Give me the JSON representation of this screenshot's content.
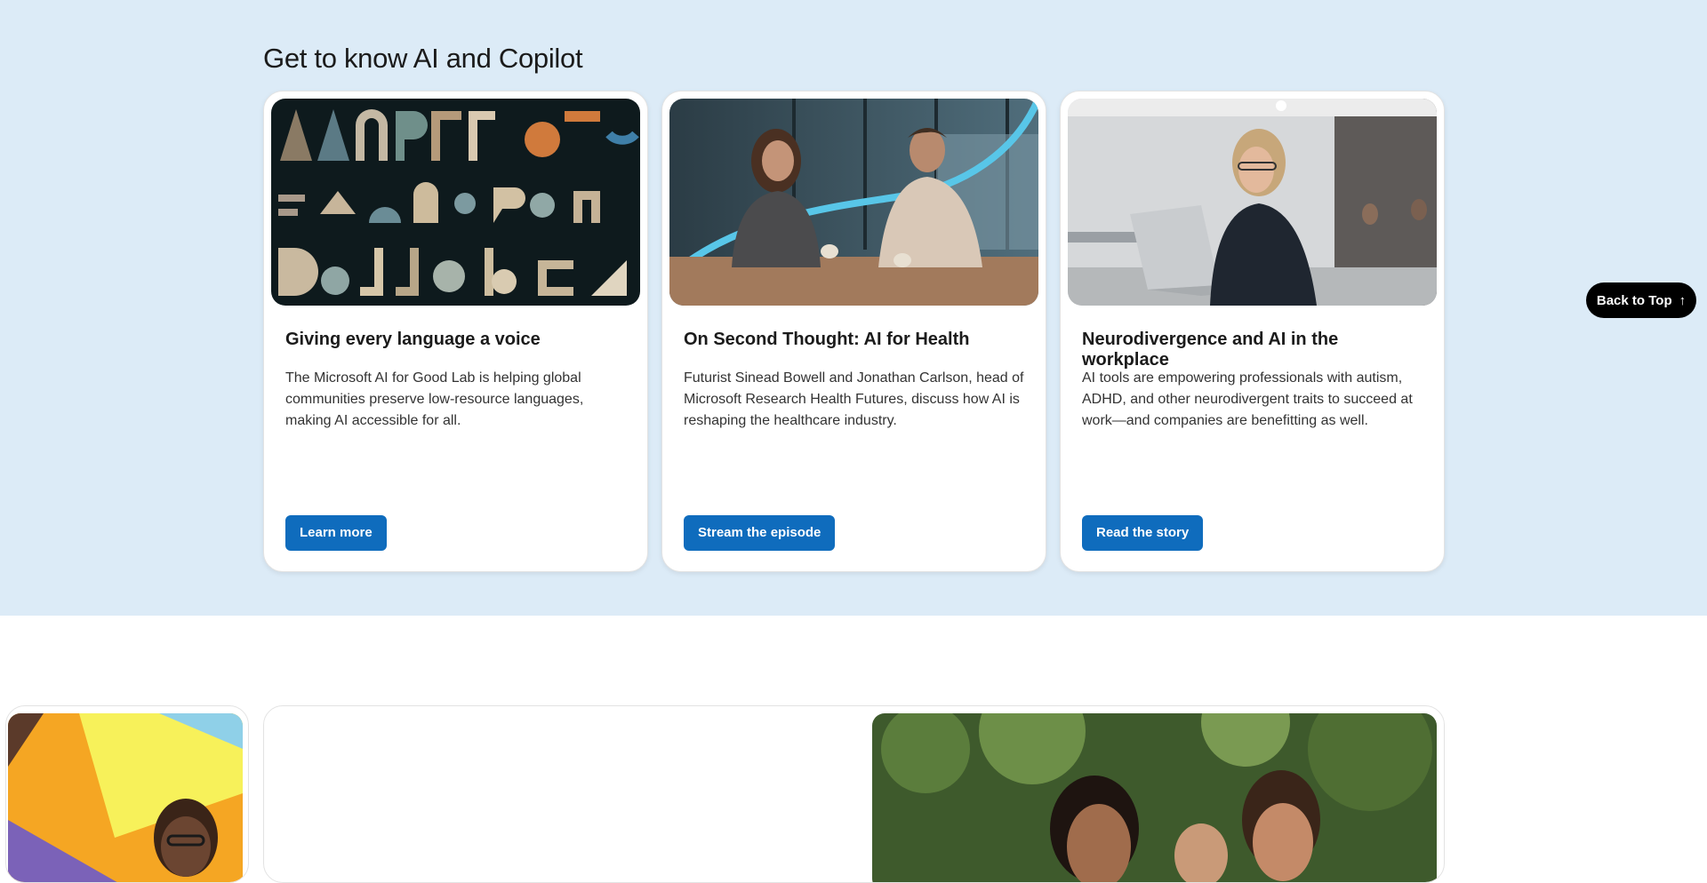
{
  "section": {
    "title": "Get to know AI and Copilot"
  },
  "cards": [
    {
      "title": "Giving every language a voice",
      "description": "The Microsoft AI for Good Lab is helping global communities preserve low-resource languages, making AI accessible for all.",
      "button": "Learn more",
      "image_icon": "syllabics-letters-image"
    },
    {
      "title": "On Second Thought: AI for Health",
      "description": "Futurist Sinead Bowell and Jonathan Carlson, head of Microsoft Research Health Futures, discuss how AI is reshaping the healthcare industry.",
      "button": "Stream the episode",
      "image_icon": "two-people-talking-image"
    },
    {
      "title": "Neurodivergence and AI in the workplace",
      "description": "AI tools are empowering professionals with autism, ADHD, and other neurodivergent traits to succeed at work—and companies are benefitting as well.",
      "button": "Read the story",
      "image_icon": "woman-laptop-image"
    }
  ],
  "back_to_top": {
    "label": "Back to Top",
    "icon": "arrow-up-icon"
  },
  "colors": {
    "band": "#dcebf7",
    "button": "#0f6cbd",
    "back_to_top": "#000000"
  }
}
